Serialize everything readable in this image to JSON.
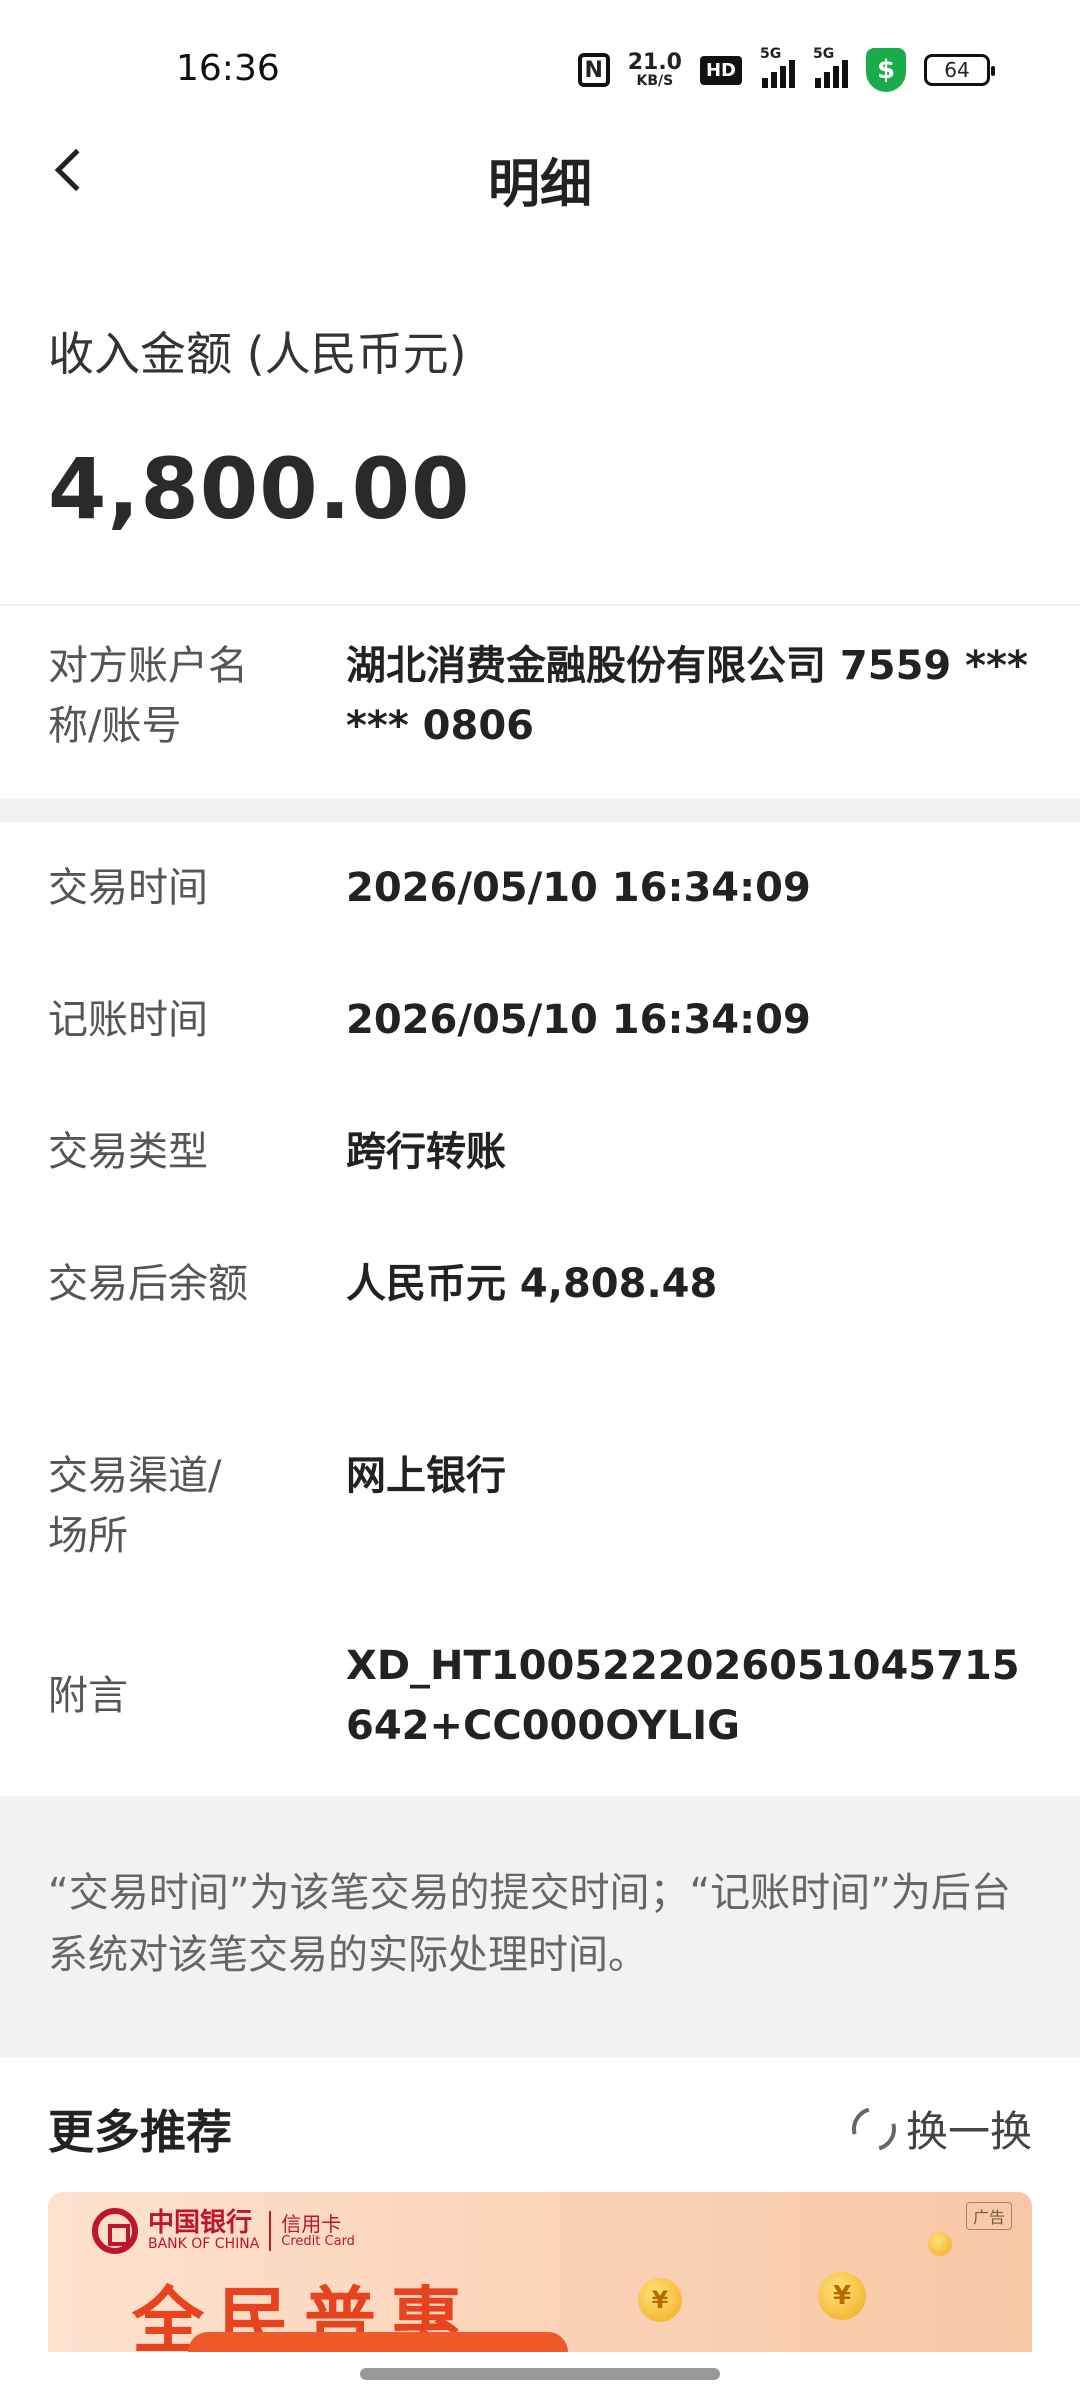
{
  "status_bar": {
    "time": "16:36",
    "nfc": "N",
    "speed_value": "21.0",
    "speed_unit": "KB/S",
    "hd": "HD",
    "signal_tag": "5G",
    "battery": "64"
  },
  "header": {
    "title": "明细"
  },
  "amount": {
    "label": "收入金额 (人民币元)",
    "value": "4,800.00"
  },
  "counterparty": {
    "label": "对方账户名称/账号",
    "value": "湖北消费金融股份有限公司 7559 ****** 0806"
  },
  "details": [
    {
      "label": "交易时间",
      "value": "2026/05/10 16:34:09"
    },
    {
      "label": "记账时间",
      "value": "2026/05/10 16:34:09"
    },
    {
      "label": "交易类型",
      "value": "跨行转账"
    },
    {
      "label": "交易后余额",
      "value": "人民币元 4,808.48"
    },
    {
      "label": "交易渠道/场所",
      "value": "网上银行"
    },
    {
      "label": "附言",
      "value": "XD_HT1005222026051045715642+CC000OYLIG"
    }
  ],
  "note": "“交易时间”为该笔交易的提交时间；“记账时间”为后台系统对该笔交易的实际处理时间。",
  "more": {
    "title": "更多推荐",
    "refresh_label": "换一换"
  },
  "banner": {
    "bank_name": "中国银行",
    "bank_name_en": "BANK OF CHINA",
    "card_label": "信用卡",
    "card_label_en": "Credit Card",
    "ad_tag": "广告",
    "headline": "全民普惠"
  }
}
